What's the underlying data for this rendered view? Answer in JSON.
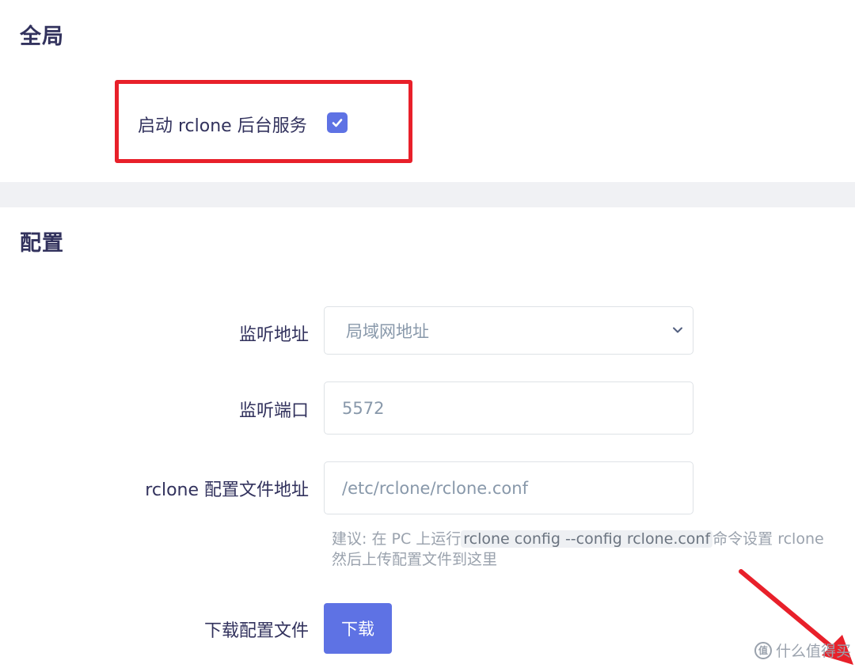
{
  "sections": {
    "global": {
      "title": "全局"
    },
    "config": {
      "title": "配置"
    }
  },
  "global": {
    "enable_label": "启动 rclone 后台服务",
    "enable_checked": true
  },
  "config": {
    "listen_addr": {
      "label": "监听地址",
      "value": "局域网地址"
    },
    "listen_port": {
      "label": "监听端口",
      "value": "5572"
    },
    "conf_path": {
      "label": "rclone 配置文件地址",
      "value": "/etc/rclone/rclone.conf"
    },
    "hint": {
      "prefix": "建议: 在 PC 上运行",
      "code": "rclone config --config rclone.conf",
      "suffix": "命令设置 rclone",
      "line2": "然后上传配置文件到这里"
    },
    "download": {
      "label": "下载配置文件",
      "button": "下载"
    }
  },
  "watermark": {
    "logo": "值",
    "text": "什么值得买"
  },
  "colors": {
    "accent": "#5e72e4",
    "highlight": "#e8202a"
  },
  "icons": {
    "checkbox": "check-icon",
    "select": "chevron-down-icon"
  }
}
